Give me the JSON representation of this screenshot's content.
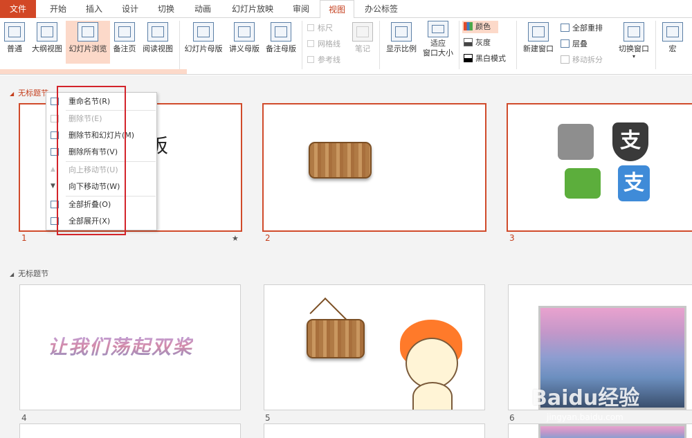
{
  "tabs": [
    "文件",
    "开始",
    "插入",
    "设计",
    "切换",
    "动画",
    "幻灯片放映",
    "审阅",
    "视图",
    "办公标签"
  ],
  "ribbon": {
    "views": [
      "普通",
      "大纲视图",
      "幻灯片浏览",
      "备注页",
      "阅读视图"
    ],
    "masters": [
      "幻灯片母版",
      "讲义母版",
      "备注母版"
    ],
    "show": [
      "标尺",
      "网格线",
      "参考线"
    ],
    "notes": "笔记",
    "zoom": "显示比例",
    "fit": [
      "适应",
      "窗口大小"
    ],
    "color": [
      "颜色",
      "灰度",
      "黑白模式"
    ],
    "new_window": "新建窗口",
    "window": [
      "全部重排",
      "层叠",
      "移动拆分"
    ],
    "switch_window": "切换窗口",
    "macro": "宏"
  },
  "sections": [
    "无标题节",
    "无标题节"
  ],
  "slides": {
    "numbers": [
      "1",
      "2",
      "3",
      "4",
      "5",
      "6"
    ],
    "slide1_text": "板",
    "slide4_text": "让我们荡起双桨",
    "star": "★"
  },
  "context_menu": [
    "重命名节(R)",
    "删除节(E)",
    "删除节和幻灯片(M)",
    "删除所有节(V)",
    "向上移动节(U)",
    "向下移动节(W)",
    "全部折叠(O)",
    "全部展开(X)"
  ],
  "watermark": [
    "Baidu经验",
    "jingyan.baidu.com"
  ],
  "colors": {
    "accent": "#d24726",
    "selection": "#fcd9c9",
    "highlight_box": "#d3232a"
  }
}
